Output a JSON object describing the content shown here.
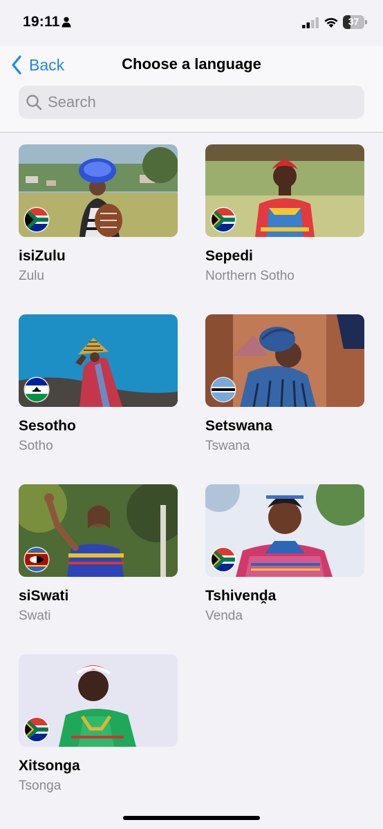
{
  "status_bar": {
    "time": "19:11",
    "battery_pct": "37",
    "battery_level": 0.37
  },
  "nav": {
    "back_label": "Back",
    "title": "Choose a language"
  },
  "search": {
    "placeholder": "Search",
    "value": ""
  },
  "colors": {
    "accent": "#1F87E8",
    "background": "#F2F2F7",
    "secondary_text": "#8A8A8E"
  },
  "languages": [
    {
      "name": "isiZulu",
      "subtitle": "Zulu",
      "flag": "south-africa-flag",
      "icon": "person-photo"
    },
    {
      "name": "Sepedi",
      "subtitle": "Northern Sotho",
      "flag": "south-africa-flag",
      "icon": "person-photo"
    },
    {
      "name": "Sesotho",
      "subtitle": "Sotho",
      "flag": "lesotho-flag",
      "icon": "person-photo"
    },
    {
      "name": "Setswana",
      "subtitle": "Tswana",
      "flag": "botswana-flag",
      "icon": "person-photo"
    },
    {
      "name": "siSwati",
      "subtitle": "Swati",
      "flag": "eswatini-flag",
      "icon": "person-photo"
    },
    {
      "name": "Tshivenḓa",
      "subtitle": "Venda",
      "flag": "south-africa-flag",
      "icon": "person-photo"
    },
    {
      "name": "Xitsonga",
      "subtitle": "Tsonga",
      "flag": "south-africa-flag",
      "icon": "person-photo"
    }
  ]
}
